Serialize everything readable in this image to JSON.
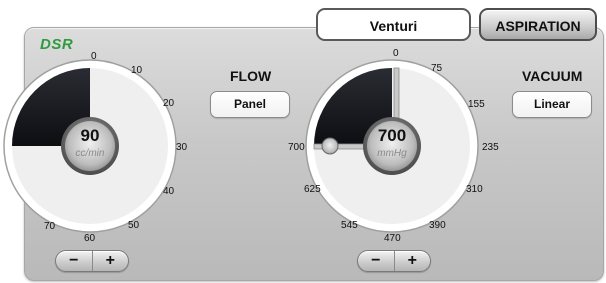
{
  "header": {
    "mode_label": "Venturi",
    "aspiration_label": "ASPIRATION"
  },
  "brand": "DSR",
  "flow": {
    "title": "FLOW",
    "control_label": "Panel",
    "value": "90",
    "unit": "cc/min",
    "ticks": [
      "0",
      "10",
      "20",
      "30",
      "40",
      "50",
      "60",
      "70"
    ],
    "level": 0.25
  },
  "vacuum": {
    "title": "VACUUM",
    "control_label": "Linear",
    "value": "700",
    "unit": "mmHg",
    "ticks": [
      "0",
      "75",
      "155",
      "235",
      "310",
      "390",
      "470",
      "545",
      "625",
      "700"
    ],
    "level": 0.25
  },
  "steppers": {
    "minus": "−",
    "plus": "+"
  },
  "colors": {
    "brand": "#2f9a3e",
    "gauge_fill": "#1c1d22",
    "gauge_face": "#f2f2f2"
  }
}
